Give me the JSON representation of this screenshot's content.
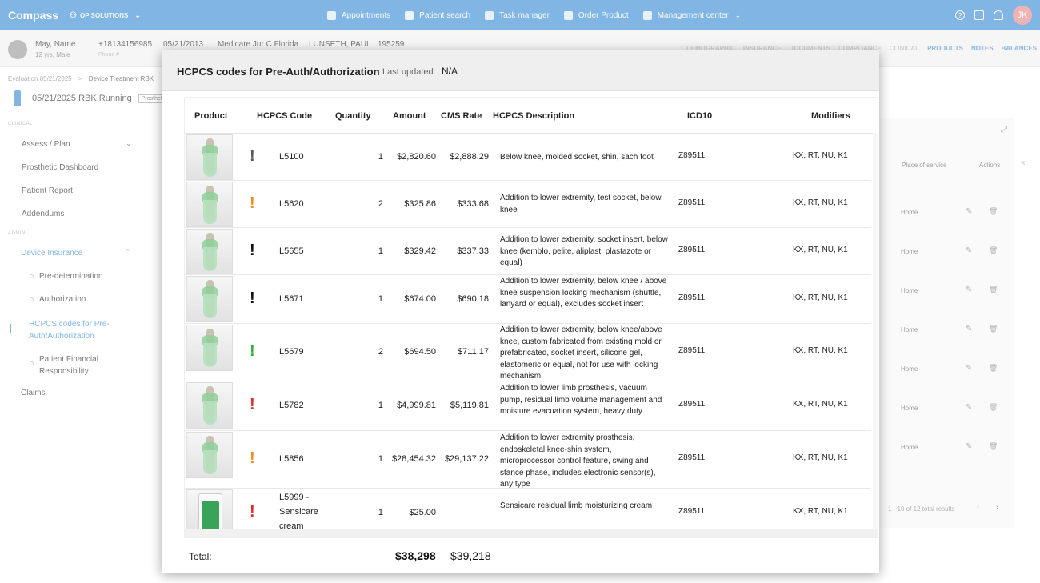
{
  "app": {
    "brand": "Compass",
    "org": "OP SOLUTIONS"
  },
  "nav": [
    {
      "label": "Appointments"
    },
    {
      "label": "Patient search"
    },
    {
      "label": "Task manager"
    },
    {
      "label": "Order Product"
    },
    {
      "label": "Management center"
    }
  ],
  "user": {
    "initials": "JK"
  },
  "patient": {
    "name": "May, Name",
    "sub": "12 yrs, Male",
    "phone": "+18134156985",
    "phone_label": "Phone #",
    "date": "05/21/2013",
    "insurance": "Medicare Jur C Florida",
    "provider": "LUNSETH, PAUL",
    "code": "195259"
  },
  "patient_tabs": [
    "DEMOGRAPHIC",
    "INSURANCE",
    "DOCUMENTS",
    "COMPLIANCE",
    "CLINICAL",
    "PRODUCTS",
    "NOTES",
    "BALANCES"
  ],
  "breadcrumb": {
    "first": "Evaluation 05/21/2025",
    "sep": ">",
    "second": "Device Treatment RBK"
  },
  "page": {
    "title": "05/21/2025 RBK Running",
    "tag": "Prosthetic"
  },
  "sidebar": {
    "sec_clinical": "CLINICAL",
    "sec_admin": "ADMIN",
    "items": [
      {
        "label": "Assess / Plan"
      },
      {
        "label": "Prosthetic Dashboard"
      },
      {
        "label": "Patient Report"
      },
      {
        "label": "Addendums"
      },
      {
        "label": "Device Insurance"
      },
      {
        "label": "Pre-determination"
      },
      {
        "label": "Authorization"
      },
      {
        "label": "HCPCS codes for Pre-Auth/Authorization"
      },
      {
        "label": "Patient Financial Responsibility"
      },
      {
        "label": "Claims"
      }
    ]
  },
  "bg_table": {
    "col_place": "Place of service",
    "col_actions": "Actions",
    "rows": [
      "Home",
      "Home",
      "Home",
      "Home",
      "Home",
      "Home",
      "Home"
    ],
    "pager": "1 - 10 of 12 total results"
  },
  "modal": {
    "title": "HCPCS codes for Pre-Auth/Authorization",
    "last_updated_label": "Last updated:",
    "last_updated_value": "N/A",
    "columns": {
      "product": "Product",
      "code": "HCPCS Code",
      "qty": "Quantity",
      "amount": "Amount",
      "cms": "CMS Rate",
      "desc": "HCPCS Description",
      "icd": "ICD10",
      "mods": "Modifiers"
    },
    "rows": [
      {
        "flag": "!",
        "flag_color": "#555555",
        "code": "L5100",
        "qty": "1",
        "amount": "$2,820.60",
        "cms": "$2,888.29",
        "desc": "Below knee, molded socket, shin, sach foot",
        "icd": "Z89511",
        "mods": "KX, RT, NU, K1"
      },
      {
        "flag": "!",
        "flag_color": "#f08c1a",
        "code": "L5620",
        "qty": "2",
        "amount": "$325.86",
        "cms": "$333.68",
        "desc": "Addition to lower extremity, test socket, below knee",
        "icd": "Z89511",
        "mods": "KX, RT, NU, K1"
      },
      {
        "flag": "!",
        "flag_color": "#111111",
        "code": "L5655",
        "qty": "1",
        "amount": "$329.42",
        "cms": "$337.33",
        "desc": "Addition to lower extremity, socket insert, below knee (kemblo, pelite, aliplast, plastazote or equal)",
        "icd": "Z89511",
        "mods": "KX, RT, NU, K1"
      },
      {
        "flag": "!",
        "flag_color": "#111111",
        "code": "L5671",
        "qty": "1",
        "amount": "$674.00",
        "cms": "$690.18",
        "desc": "Addition to lower extremity, below knee / above knee suspension locking mechanism (shuttle, lanyard or equal), excludes socket insert",
        "icd": "Z89511",
        "mods": "KX, RT, NU, K1"
      },
      {
        "flag": "!",
        "flag_color": "#2fae3a",
        "code": "L5679",
        "qty": "2",
        "amount": "$694.50",
        "cms": "$711.17",
        "desc": "Addition to lower extremity, below knee/above knee, custom fabricated from existing mold or prefabricated, socket insert, silicone gel, elastomeric or equal, not for use with locking mechanism",
        "icd": "Z89511",
        "mods": "KX, RT, NU, K1"
      },
      {
        "flag": "!",
        "flag_color": "#d92b2b",
        "code": "L5782",
        "qty": "1",
        "amount": "$4,999.81",
        "cms": "$5,119.81",
        "desc": "Addition to lower limb prosthesis, vacuum pump, residual limb volume management and moisture evacuation system, heavy duty",
        "icd": "Z89511",
        "mods": "KX, RT, NU, K1"
      },
      {
        "flag": "!",
        "flag_color": "#f08c1a",
        "code": "L5856",
        "qty": "1",
        "amount": "$28,454.32",
        "cms": "$29,137.22",
        "desc": "Addition to lower extremity prosthesis, endoskeletal knee-shin system, microprocessor control feature, swing and stance phase, includes electronic sensor(s), any type",
        "icd": "Z89511",
        "mods": "KX, RT, NU, K1"
      },
      {
        "flag": "!",
        "flag_color": "#d92b2b",
        "code": "L5999 - Sensicare cream",
        "qty": "1",
        "amount": "$25.00",
        "cms": "",
        "desc": "Sensicare residual limb moisturizing cream",
        "icd": "Z89511",
        "mods": "KX, RT, NU, K1"
      }
    ],
    "total_label": "Total:",
    "total_amount": "$38,298",
    "total_cms": "$39,218"
  }
}
